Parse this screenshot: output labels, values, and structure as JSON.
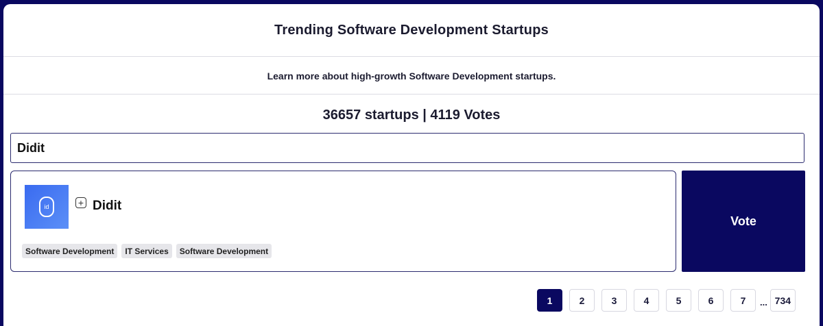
{
  "header": {
    "title": "Trending Software Development Startups",
    "subtitle": "Learn more about high-growth Software Development startups.",
    "stats": "36657 startups | 4119 Votes"
  },
  "search": {
    "value": "Didit"
  },
  "card": {
    "logo_text": "id",
    "expand_symbol": "+",
    "name": "Didit",
    "tags": [
      "Software Development",
      "IT Services",
      "Software Development"
    ]
  },
  "vote": {
    "label": "Vote"
  },
  "pagination": {
    "pages": [
      "1",
      "2",
      "3",
      "4",
      "5",
      "6",
      "7"
    ],
    "ellipsis": "...",
    "last": "734"
  },
  "colors": {
    "accent": "#0a0860",
    "logo": "#4a7cf3",
    "tag_bg": "#e6e6ea"
  }
}
